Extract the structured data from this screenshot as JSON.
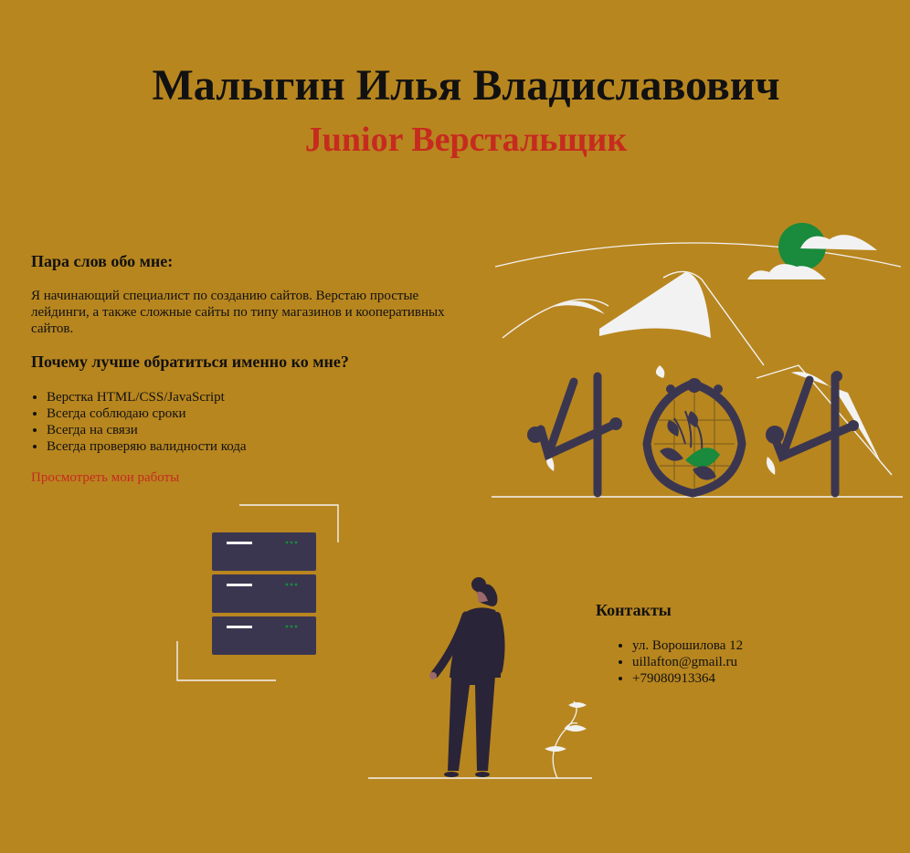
{
  "header": {
    "name": "Малыгин Илья Владиславович",
    "position": "Junior Верстальщик"
  },
  "about": {
    "heading": "Пара слов обо мне:",
    "text": "Я начинающий специалист по созданию сайтов. Верстаю простые лейдинги, а также сложные сайты по типу магазинов и кооперативных сайтов."
  },
  "why": {
    "heading": "Почему лучше обратиться именно ко мне?",
    "items": [
      "Верстка HTML/CSS/JavaScript",
      "Всегда соблюдаю сроки",
      "Всегда на связи",
      "Всегда проверяю валидности кода"
    ]
  },
  "works_link": "Просмотреть мои работы",
  "contacts": {
    "heading": "Контакты",
    "items": [
      "ул. Ворошилова 12",
      "uillafton@gmail.ru",
      "+79080913364"
    ]
  },
  "colors": {
    "background": "#b8861f",
    "accent": "#c62b1f",
    "dark": "#3b3650",
    "green": "#1a8a3c"
  },
  "illustrations": [
    "illustration-404",
    "server-stack-illustration",
    "person-standing-illustration"
  ]
}
